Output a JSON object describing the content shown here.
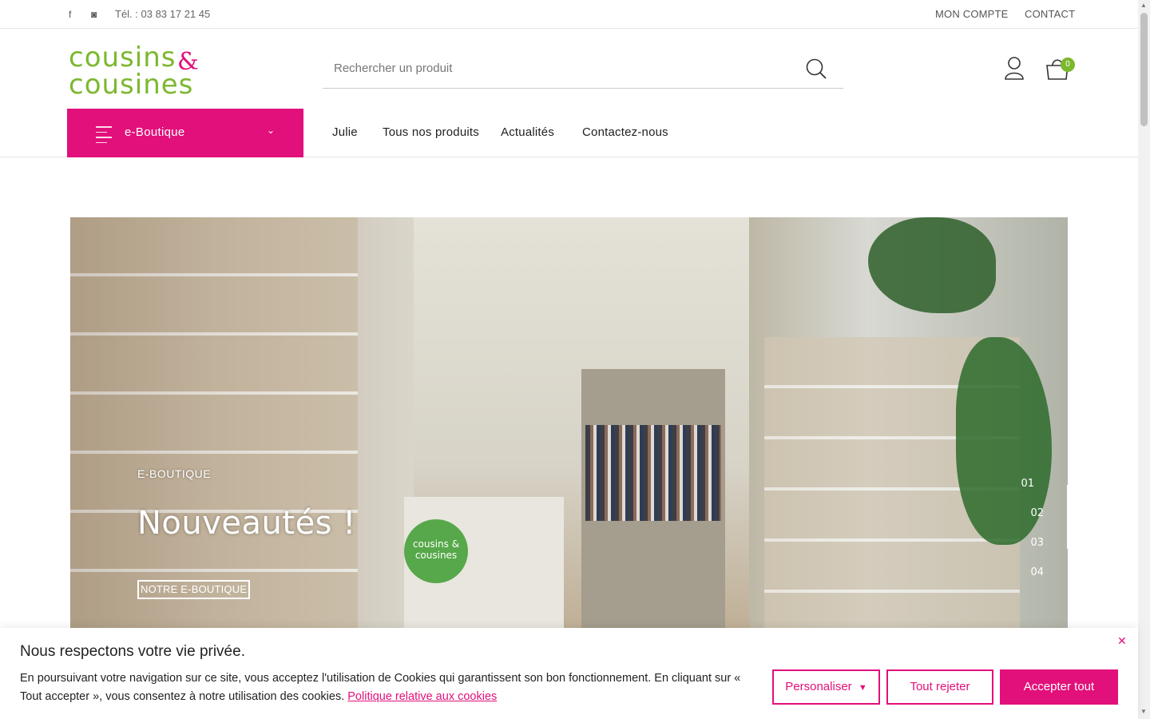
{
  "topbar": {
    "facebook_icon": "f",
    "instagram_icon": "◙",
    "phone": "Tél. : 03 83 17 21 45",
    "my_account": "MON COMPTE",
    "contact": "CONTACT"
  },
  "logo": {
    "line1": "cousins",
    "ampersand": "&",
    "line2": "cousines"
  },
  "search": {
    "placeholder": "Rechercher un produit"
  },
  "cart": {
    "count": "0"
  },
  "nav": {
    "eboutique": "e-Boutique",
    "links": [
      "Julie",
      "Tous nos produits",
      "Actualités",
      "Contactez-nous"
    ]
  },
  "hero": {
    "kicker": "E-BOUTIQUE",
    "title": "Nouveautés !",
    "cta": "NOTRE E-BOUTIQUE",
    "slides": [
      "01",
      "02",
      "03",
      "04"
    ],
    "shop_sign": "cousins & cousines"
  },
  "cookie": {
    "title": "Nous respectons votre vie privée.",
    "text": "En poursuivant votre navigation sur ce site, vous acceptez l'utilisation de Cookies qui garantissent son bon fonctionnement. En cliquant sur « Tout accepter », vous consentez à notre utilisation des cookies.",
    "policy_link": "Politique relative aux cookies",
    "customize": "Personaliser",
    "reject": "Tout rejeter",
    "accept": "Accepter tout"
  },
  "colors": {
    "brand_pink": "#e2107a",
    "brand_green": "#7cb82f"
  }
}
